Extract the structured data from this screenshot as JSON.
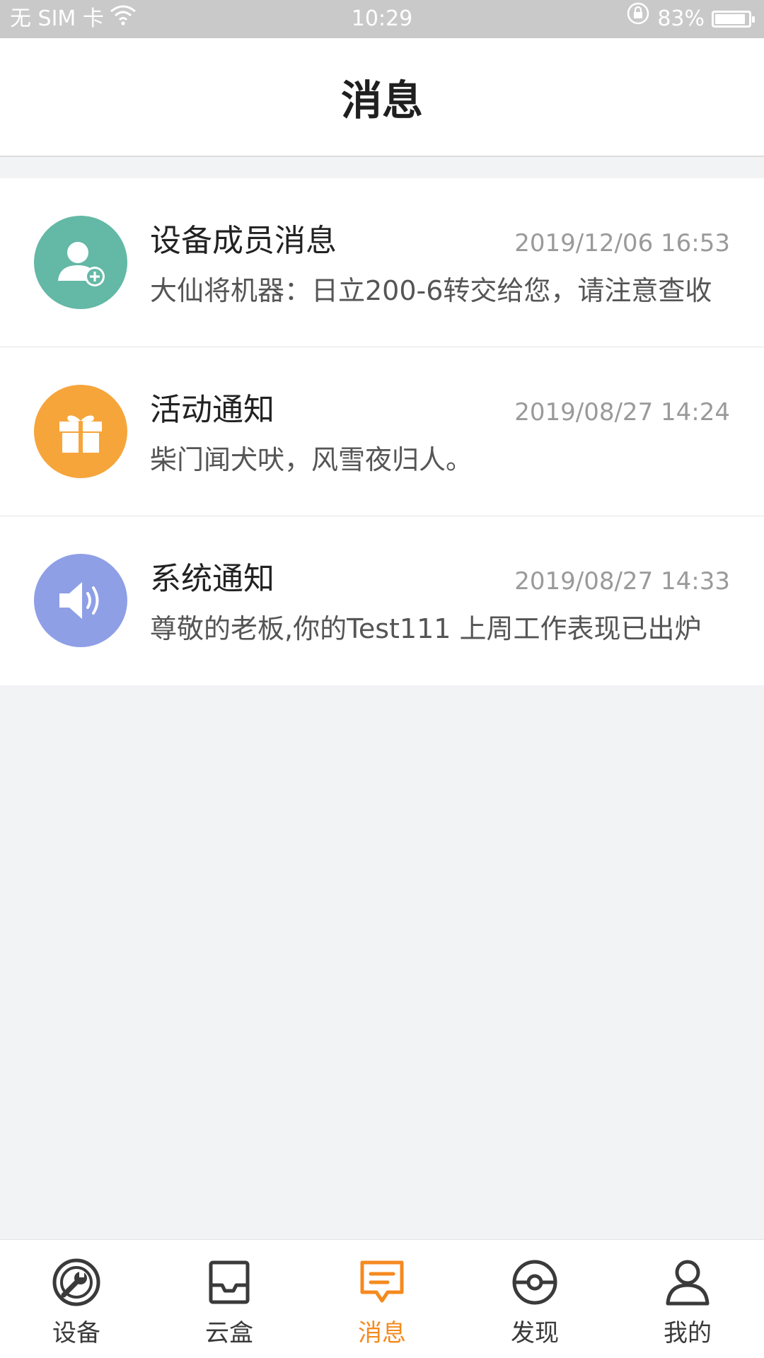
{
  "status_bar": {
    "carrier": "无 SIM 卡",
    "time": "10:29",
    "battery_percent": "83%",
    "battery_level": 0.83
  },
  "header": {
    "title": "消息"
  },
  "messages": [
    {
      "title": "设备成员消息",
      "time": "2019/12/06 16:53",
      "preview": "大仙将机器：日立200-6转交给您，请注意查收",
      "icon": "add-user-icon",
      "color": "#64b8a6"
    },
    {
      "title": "活动通知",
      "time": "2019/08/27 14:24",
      "preview": "柴门闻犬吠，风雪夜归人。",
      "icon": "gift-icon",
      "color": "#f6a53b"
    },
    {
      "title": "系统通知",
      "time": "2019/08/27 14:33",
      "preview": "尊敬的老板,你的Test111 上周工作表现已出炉",
      "icon": "speaker-icon",
      "color": "#8e9fe6"
    }
  ],
  "nav": {
    "active_color": "#f58a1f",
    "items": [
      {
        "label": "设备",
        "icon": "device-icon"
      },
      {
        "label": "云盒",
        "icon": "inbox-icon"
      },
      {
        "label": "消息",
        "icon": "message-icon"
      },
      {
        "label": "发现",
        "icon": "discover-icon"
      },
      {
        "label": "我的",
        "icon": "profile-icon"
      }
    ]
  }
}
